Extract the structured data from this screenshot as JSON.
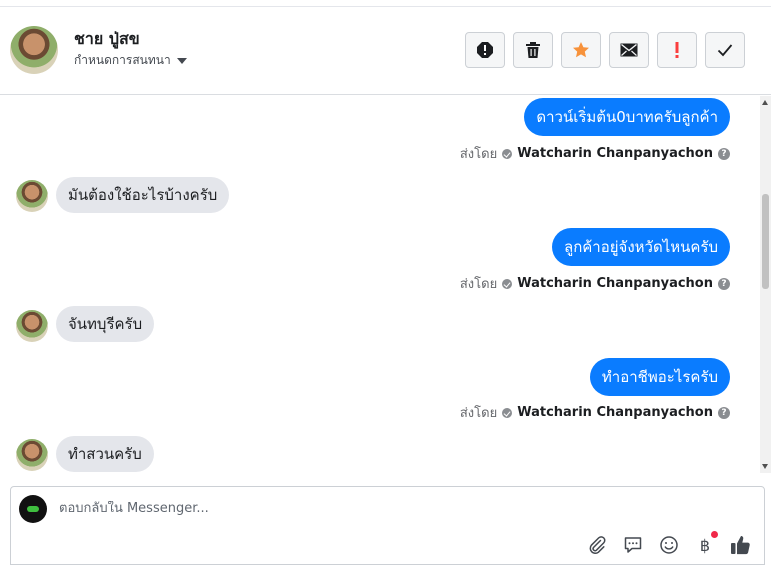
{
  "header": {
    "contact_name": "ชาย ปู่สข",
    "contact_subtitle": "กำหนดการสนทนา",
    "actions": [
      {
        "name": "report-spam",
        "icon": "alert-circle-icon"
      },
      {
        "name": "delete",
        "icon": "trash-icon"
      },
      {
        "name": "star",
        "icon": "star-icon",
        "color": "#f7923b"
      },
      {
        "name": "mark-unread",
        "icon": "envelope-icon"
      },
      {
        "name": "follow-up",
        "icon": "exclamation-icon",
        "color": "#fa3e3e"
      },
      {
        "name": "mark-done",
        "icon": "checkmark-icon"
      }
    ]
  },
  "messages": [
    {
      "direction": "out",
      "text": "ดาวน์เริ่มต้น0บาทครับลูกค้า"
    },
    {
      "direction": "meta",
      "prefix": "ส่งโดย",
      "agent": "Watcharin Chanpanyachon"
    },
    {
      "direction": "in",
      "text": "มันต้องใช้อะไรบ้างครับ"
    },
    {
      "direction": "out",
      "text": "ลูกค้าอยู่จังหวัดไหนครับ"
    },
    {
      "direction": "meta",
      "prefix": "ส่งโดย",
      "agent": "Watcharin Chanpanyachon"
    },
    {
      "direction": "in",
      "text": "จันทบุรีครับ"
    },
    {
      "direction": "out",
      "text": "ทำอาชีพอะไรครับ"
    },
    {
      "direction": "meta",
      "prefix": "ส่งโดย",
      "agent": "Watcharin Chanpanyachon"
    },
    {
      "direction": "in",
      "text": "ทำสวนครับ"
    }
  ],
  "composer": {
    "placeholder": "ตอบกลับใน Messenger...",
    "tools": [
      "paperclip-icon",
      "saved-reply-icon",
      "emoji-icon",
      "baht-payment-icon",
      "thumbs-up-icon"
    ],
    "baht_symbol": "฿"
  },
  "colors": {
    "outgoing_bubble": "#0a7cff",
    "incoming_bubble": "#e4e6eb",
    "accent": "#0a7cff"
  }
}
